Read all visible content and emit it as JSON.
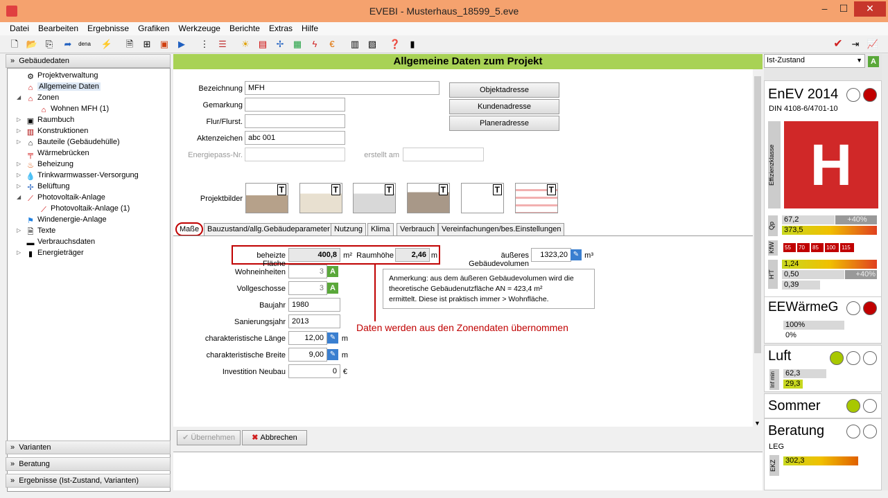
{
  "window": {
    "title": "EVEBI - Musterhaus_18599_5.eve",
    "min": "–",
    "max": "☐",
    "close": "✕"
  },
  "menu": [
    "Datei",
    "Bearbeiten",
    "Ergebnisse",
    "Grafiken",
    "Werkzeuge",
    "Berichte",
    "Extras",
    "Hilfe"
  ],
  "toolbar": {
    "dena": "dena"
  },
  "left": {
    "header": "Gebäudedaten",
    "tree": [
      "Projektverwaltung",
      "Allgemeine Daten",
      "Zonen",
      "Wohnen MFH (1)",
      "Raumbuch",
      "Konstruktionen",
      "Bauteile (Gebäudehülle)",
      "Wärmebrücken",
      "Beheizung",
      "Trinkwarmwasser-Versorgung",
      "Belüftung",
      "Photovoltaik-Anlage",
      "Photovoltaik-Anlage (1)",
      "Windenergie-Anlage",
      "Texte",
      "Verbrauchsdaten",
      "Energieträger"
    ],
    "bottom": [
      "Varianten",
      "Beratung",
      "Ergebnisse (Ist-Zustand, Varianten)"
    ]
  },
  "main": {
    "title": "Allgemeine Daten zum Projekt",
    "labels": {
      "bezeichnung": "Bezeichnung",
      "gemarkung": "Gemarkung",
      "flur": "Flur/Flurst.",
      "akten": "Aktenzeichen",
      "energie": "Energiepass-Nr.",
      "erstellt": "erstellt am",
      "bilder": "Projektbilder"
    },
    "values": {
      "bezeichnung": "MFH",
      "akten": "abc 001"
    },
    "buttons": {
      "objekt": "Objektadresse",
      "kunde": "Kundenadresse",
      "planer": "Planeradresse",
      "uebernehmen": "Übernehmen",
      "abbrechen": "Abbrechen"
    },
    "tabs": [
      "Maße",
      "Bauzustand/allg.Gebäudeparameter",
      "Nutzung",
      "Klima",
      "Verbrauch",
      "Vereinfachungen/bes.Einstellungen"
    ],
    "masse": {
      "beheizt_label": "beheizte Fläche",
      "beheizt": "400,8",
      "m2": "m²",
      "raumhoehe_label": "Raumhöhe",
      "raumhoehe": "2,46",
      "m": "m",
      "volumen_label": "äußeres Gebäudevolumen",
      "volumen": "1323,20",
      "m3": "m³",
      "wohn_label": "Wohneinheiten",
      "wohn": "3",
      "voll_label": "Vollgeschosse",
      "voll": "3",
      "bau_label": "Baujahr",
      "bau": "1980",
      "san_label": "Sanierungsjahr",
      "san": "2013",
      "laenge_label": "charakteristische Länge",
      "laenge": "12,00",
      "breite_label": "charakteristische Breite",
      "breite": "9,00",
      "inv_label": "Investition Neubau",
      "inv": "0",
      "euro": "€",
      "note1": "Anmerkung: aus dem äußeren Gebäudevolumen wird die",
      "note2": "theoretische Gebäudenutzfläche AN =   423,4 m²",
      "note3": "ermittelt.  Diese ist praktisch immer > Wohnfläche.",
      "annot": "Daten werden aus den Zonendaten übernommen"
    }
  },
  "right": {
    "select": "Ist-Zustand",
    "enev": "EnEV 2014",
    "din": "DIN 4108-6/4701-10",
    "effz": "Effizienzklasse",
    "klasse": "H",
    "qp": "Qp",
    "qp1": "67,2",
    "qp1b": "+40%",
    "qp2": "373,5",
    "kfw": "KfW",
    "kfwv": [
      "55",
      "70",
      "85",
      "100",
      "115"
    ],
    "ht": "H'T",
    "ht1": "1,24",
    "ht2": "0,50",
    "ht2b": "+40%",
    "ht3": "0,39",
    "ee": "EEWärmeG",
    "ee1": "100%",
    "ee2": "0%",
    "luft": "Luft",
    "infmin": "Inf min",
    "l1": "62,3",
    "l2": "29,3",
    "sommer": "Sommer",
    "beratung": "Beratung",
    "leg": "LEG",
    "ekz": "EKZ",
    "ekzv": "302,3"
  },
  "colors": {
    "header_green": "#a8d255",
    "accent_red": "#c00000",
    "title_orange": "#f5a26e"
  }
}
